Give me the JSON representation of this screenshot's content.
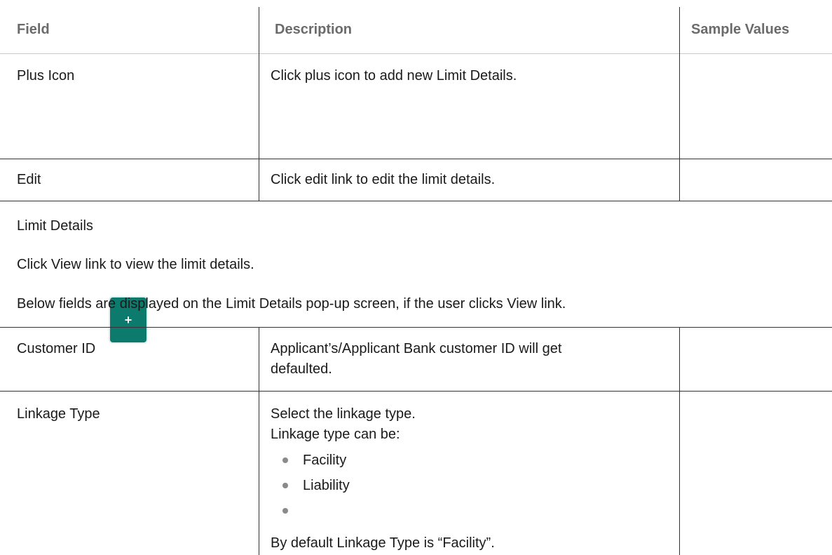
{
  "table1": {
    "headers": [
      "Field",
      "Description",
      "Sample Values"
    ],
    "rows": [
      {
        "field": "Plus Icon",
        "description": "Click plus icon to add new Limit Details.",
        "icon": "plus-icon",
        "icon_glyph": "+"
      },
      {
        "field": "Edit",
        "description": "Click edit link to edit the limit details."
      }
    ]
  },
  "section": {
    "title": "Limit Details",
    "para1": "Click View link to view the limit details.",
    "para2": "Below fields are displayed on the Limit Details pop-up screen, if the user clicks View link."
  },
  "table2": {
    "rows": [
      {
        "field": "Customer ID",
        "description_lines": [
          "Applicant’s/Applicant Bank customer ID will get",
          "defaulted."
        ]
      },
      {
        "field": "Linkage Type",
        "description_lines": [
          "Select the linkage type.",
          "Linkage type can be:"
        ],
        "bullets": [
          "Facility",
          "Liability",
          ""
        ],
        "footer": "By default Linkage Type is “Facility”."
      }
    ]
  },
  "colors": {
    "accent": "#0c7a6c",
    "header_text": "#6b6b6b",
    "rule": "#333333"
  }
}
